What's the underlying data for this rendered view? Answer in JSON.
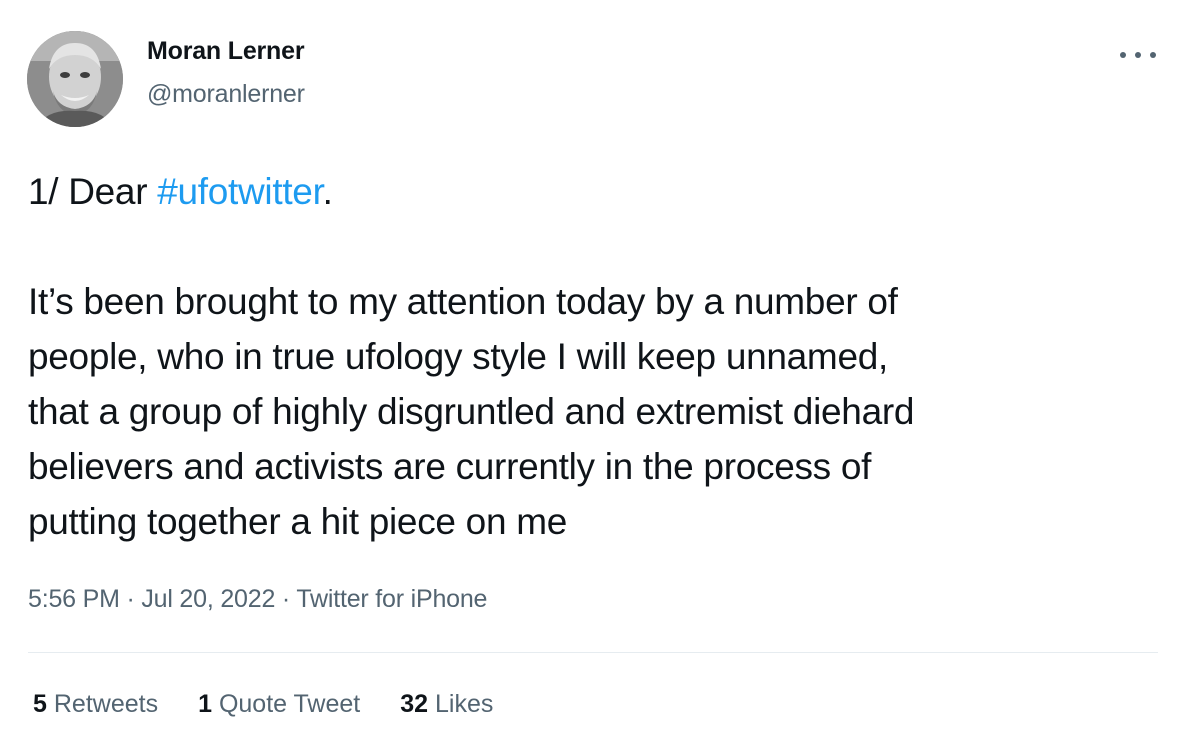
{
  "author": {
    "name": "Moran Lerner",
    "handle": "@moranlerner",
    "avatar_icon": "profile-photo"
  },
  "more_icon": "more-horizontal-icon",
  "tweet": {
    "intro_prefix": "1/ Dear ",
    "hashtag": "#ufotwitter",
    "intro_suffix": ".",
    "lines": [
      "It’s been brought to my attention today by a number of",
      "people, who in true ufology style I will keep unnamed,",
      "that a group of highly disgruntled and extremist diehard",
      "believers and activists are currently in the process of",
      "putting together a hit piece on me"
    ]
  },
  "meta": {
    "time": "5:56 PM",
    "sep1": " · ",
    "date": "Jul 20, 2022",
    "sep2": " · ",
    "source": "Twitter for iPhone"
  },
  "stats": {
    "retweets_count": "5",
    "retweets_label": "Retweets",
    "quotes_count": "1",
    "quotes_label": "Quote Tweet",
    "likes_count": "32",
    "likes_label": "Likes"
  },
  "colors": {
    "text": "#0f1419",
    "secondary": "#536471",
    "link": "#1d9bf0",
    "divider": "#e6ecf0"
  }
}
